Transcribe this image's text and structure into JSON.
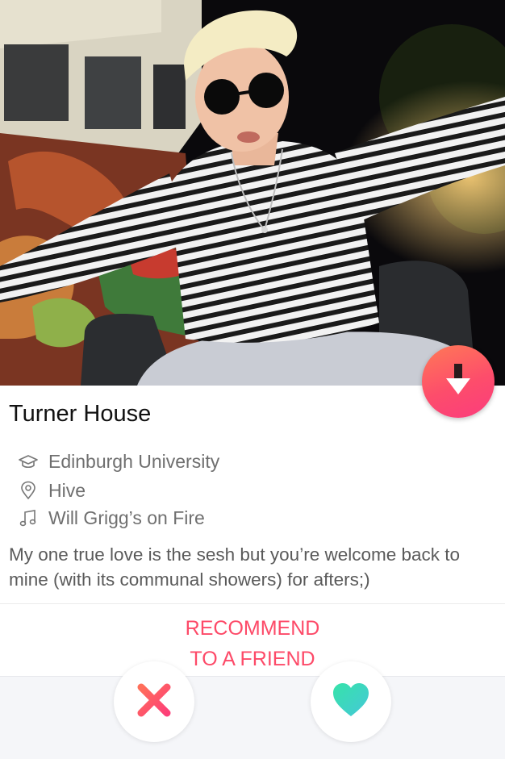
{
  "profile": {
    "name": "Turner House",
    "school": "Edinburgh University",
    "location": "Hive",
    "anthem": "Will Grigg’s on Fire",
    "bio": "My one true love is the sesh but you’re welcome back to mine (with its communal showers) for afters;)"
  },
  "actions": {
    "recommend_line1": "RECOMMEND",
    "recommend_line2": "TO A FRIEND"
  },
  "icons": {
    "collapse": "arrow-down-icon",
    "school": "graduation-cap-icon",
    "location": "location-pin-icon",
    "anthem": "music-note-icon",
    "nope": "x-icon",
    "like": "heart-icon"
  },
  "colors": {
    "accent": "#fd4a68",
    "fab_gradient_start": "#ff7a56",
    "fab_gradient_end": "#fb3c7d",
    "like": "#3fe0b0",
    "nope": "#fd4d6b"
  }
}
